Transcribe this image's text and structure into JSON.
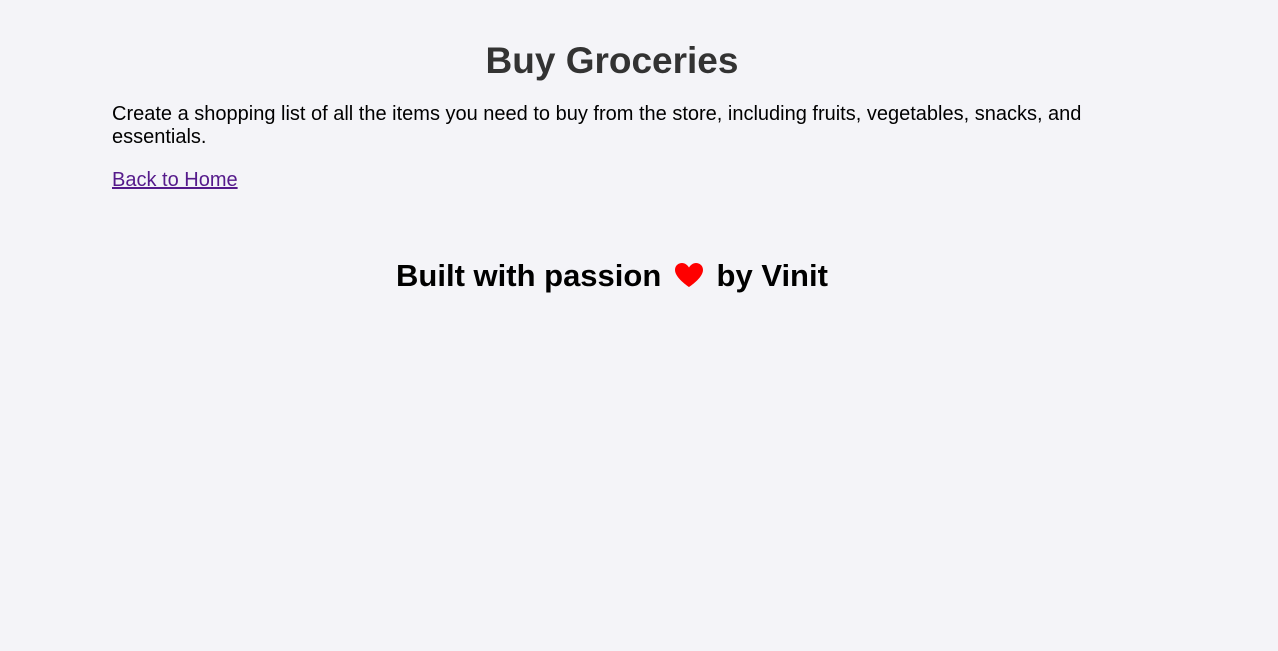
{
  "page": {
    "title": "Buy Groceries",
    "description": "Create a shopping list of all the items you need to buy from the store, including fruits, vegetables, snacks, and essentials.",
    "back_link_label": "Back to Home"
  },
  "footer": {
    "prefix": "Built with passion",
    "icon": "heart-icon",
    "suffix": "by Vinit",
    "heart_color": "#ff0000"
  },
  "colors": {
    "background": "#f4f4f8",
    "title": "#333333",
    "link": "#551a8b"
  }
}
